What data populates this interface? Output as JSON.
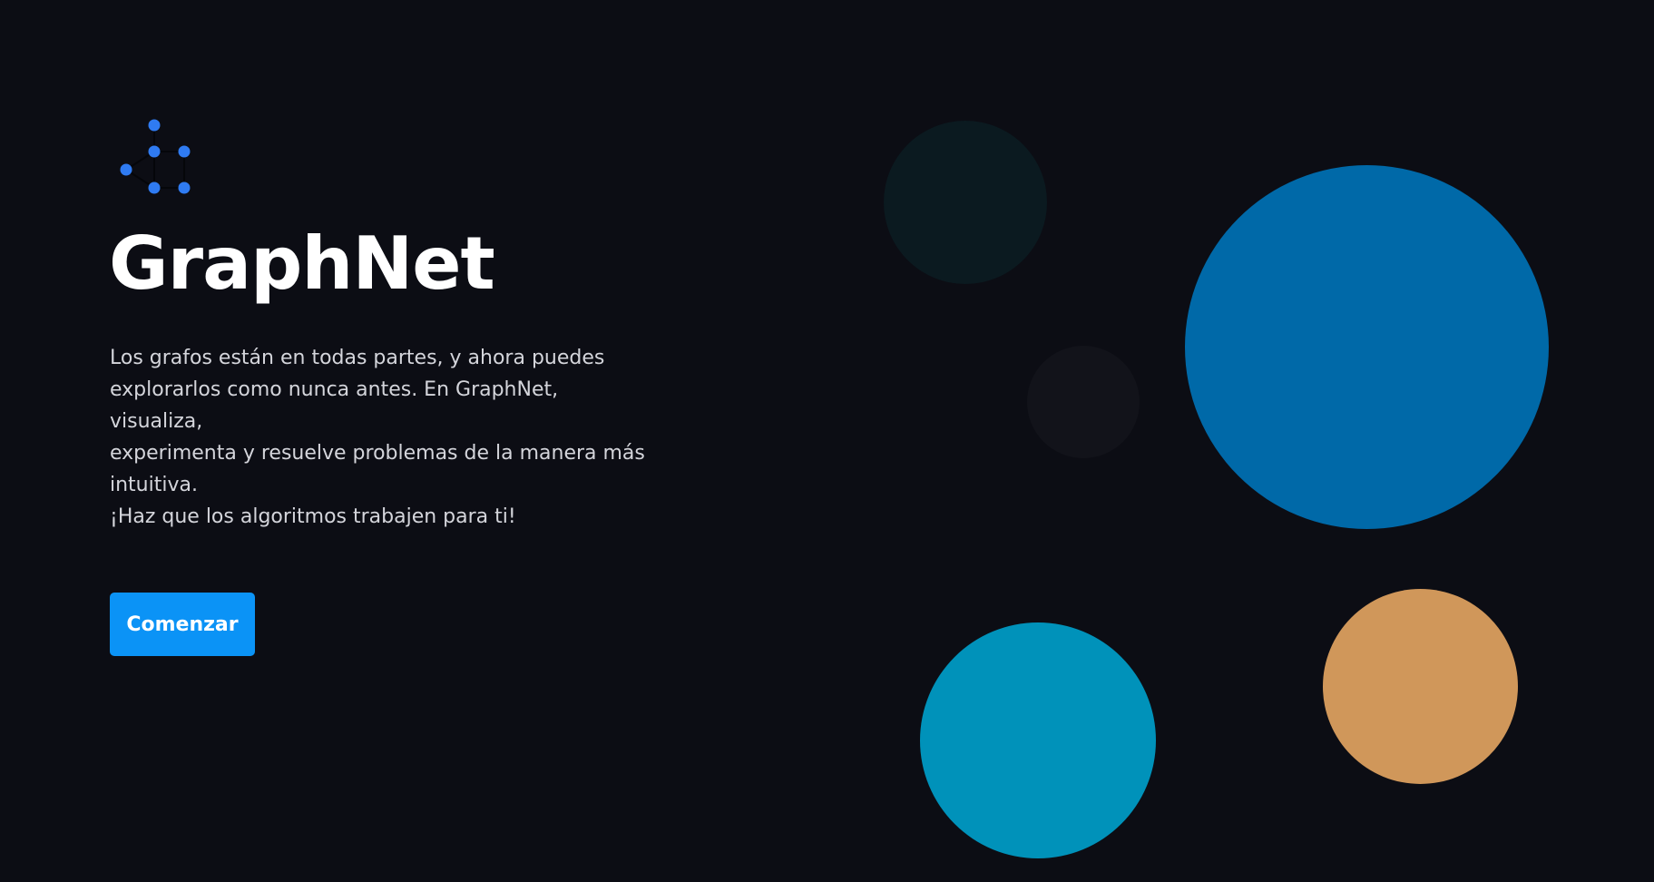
{
  "app": {
    "logo_icon": "graph-network-icon",
    "title": "GraphNet"
  },
  "hero": {
    "description_lines": [
      "Los grafos están en todas partes, y ahora puedes",
      "explorarlos como nunca antes. En GraphNet, visualiza,",
      "experimenta y resuelve problemas de la manera más",
      "intuitiva.",
      "¡Haz que los algoritmos trabajen para ti!"
    ],
    "cta_label": "Comenzar"
  },
  "colors": {
    "background": "#0c0d14",
    "logo_node": "#2f7bf2",
    "button": "#0b93f6",
    "bubble_teal_dark": "#0b1a20",
    "bubble_gray_dark": "#12131a",
    "bubble_blue": "#0069a8",
    "bubble_cyan": "#0092ba",
    "bubble_orange": "#d0975a"
  }
}
